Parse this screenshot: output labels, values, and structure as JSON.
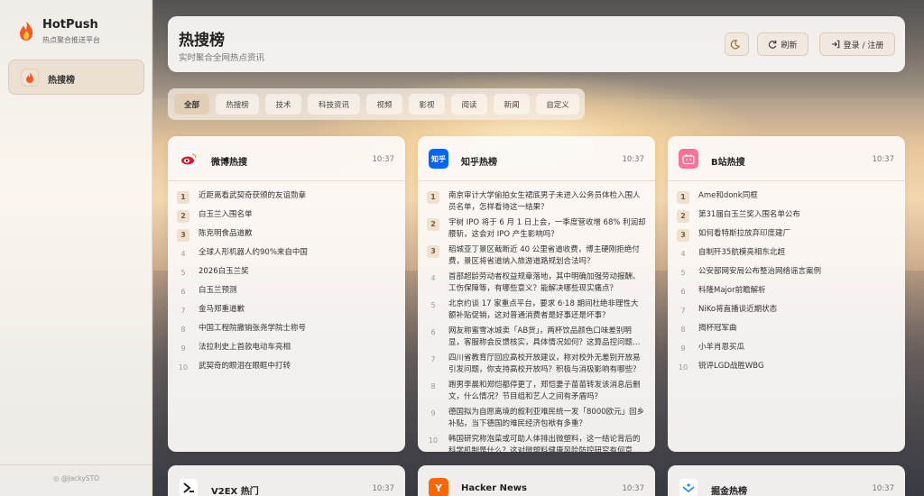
{
  "app": {
    "name": "HotPush",
    "subtitle": "热点聚合推送平台",
    "footer": "@JackySTO"
  },
  "sidebar": {
    "items": [
      {
        "label": "热搜榜",
        "icon": "flame-icon"
      }
    ]
  },
  "header": {
    "title": "热搜榜",
    "subtitle": "实时聚合全网热点资讯",
    "theme_icon": "moon-icon",
    "refresh_label": "刷新",
    "login_label": "登录 / 注册"
  },
  "tabs": [
    "全部",
    "热搜榜",
    "技术",
    "科技资讯",
    "视频",
    "影视",
    "阅读",
    "新闻",
    "自定义"
  ],
  "active_tab": "全部",
  "colors": {
    "accent": "#efe1cf",
    "weibo": "#e6162d",
    "zhihu": "#0066ff",
    "bilibili": "#fb7299",
    "hn": "#ff6600",
    "juejin": "#1e80ff"
  },
  "cards": [
    {
      "name": "微博热搜",
      "time": "10:37",
      "icon": "weibo-icon",
      "items": [
        "近距离看武契奇获颁的友谊勋章",
        "白玉兰入围名单",
        "陈克明食品道歉",
        "全球人形机器人约90%来自中国",
        "2026白玉兰奖",
        "白玉兰预测",
        "金马郑重道歉",
        "中国工程院撤销张尧学院士称号",
        "法拉利史上首款电动车亮相",
        "武契奇的眼泪在眼眶中打转"
      ]
    },
    {
      "name": "知乎热榜",
      "time": "10:37",
      "icon": "zhihu-icon",
      "items": [
        "南京审计大学偷拍女生裙底男子未进入公务员体检入围人员名单，怎样看待这一结果？",
        "宇树 IPO 将于 6 月 1 日上会，一季度营收增 68% 利润却腰斩，这会对 IPO 产生影响吗？",
        "稻城亚丁景区截断近 40 公里省道收费，博主硬刚拒绝付费，景区将省道纳入旅游道路规划合法吗？",
        "首部超龄劳动者权益规章落地，其中明确加强劳动报酬、工伤保障等，有哪些意义？能解决哪些现实痛点？",
        "北京约谈 17 家重点平台，要求 6·18 期间杜绝非理性大额补贴促销，这对普通消费者是好事还是坏事？",
        "网友称蜜雪冰城卖「AB货」，两杯饮品颜色口味差别明显，客服称会反馈核实，具体情况如何？这算品控问题…",
        "四川省教育厅回应高校开放建议，称对校外无差别开放易引发问题，你支持高校开放吗？积极与消极影响有哪些？",
        "跑男李晨和郑恺都停更了，郑恺妻子苗苗转发该消息后删文，什么情况？节目组和艺人之间有矛盾吗？",
        "德国拟为自愿离境的叙利亚难民统一发「8000欧元」回乡补贴，当下德国的难民经济包袱有多重？",
        "韩国研究称泡菜或可助人体排出微塑料，这一结论背后的科学机制是什么？这对微塑料健康风险防控研究有何意…"
      ]
    },
    {
      "name": "B站热搜",
      "time": "10:37",
      "icon": "bilibili-icon",
      "items": [
        "Ame和donk同框",
        "第31届白玉兰奖入围名单公布",
        "如何看特斯拉放弃印度建厂",
        "自制歼35航模亮相东北超",
        "公安部网安局公布整治网络谣言案例",
        "科隆Major前瞻解析",
        "NiKo将直播谈近期状态",
        "揭杯冠军曲",
        "小羊肖恩买瓜",
        "锐评LGD战胜WBG"
      ]
    },
    {
      "name": "V2EX 热门",
      "time": "10:37",
      "icon": "v2ex-icon",
      "items": []
    },
    {
      "name": "Hacker News",
      "time": "10:37",
      "icon": "hackernews-icon",
      "items": []
    },
    {
      "name": "掘金热榜",
      "time": "10:37",
      "icon": "juejin-icon",
      "items": []
    }
  ]
}
